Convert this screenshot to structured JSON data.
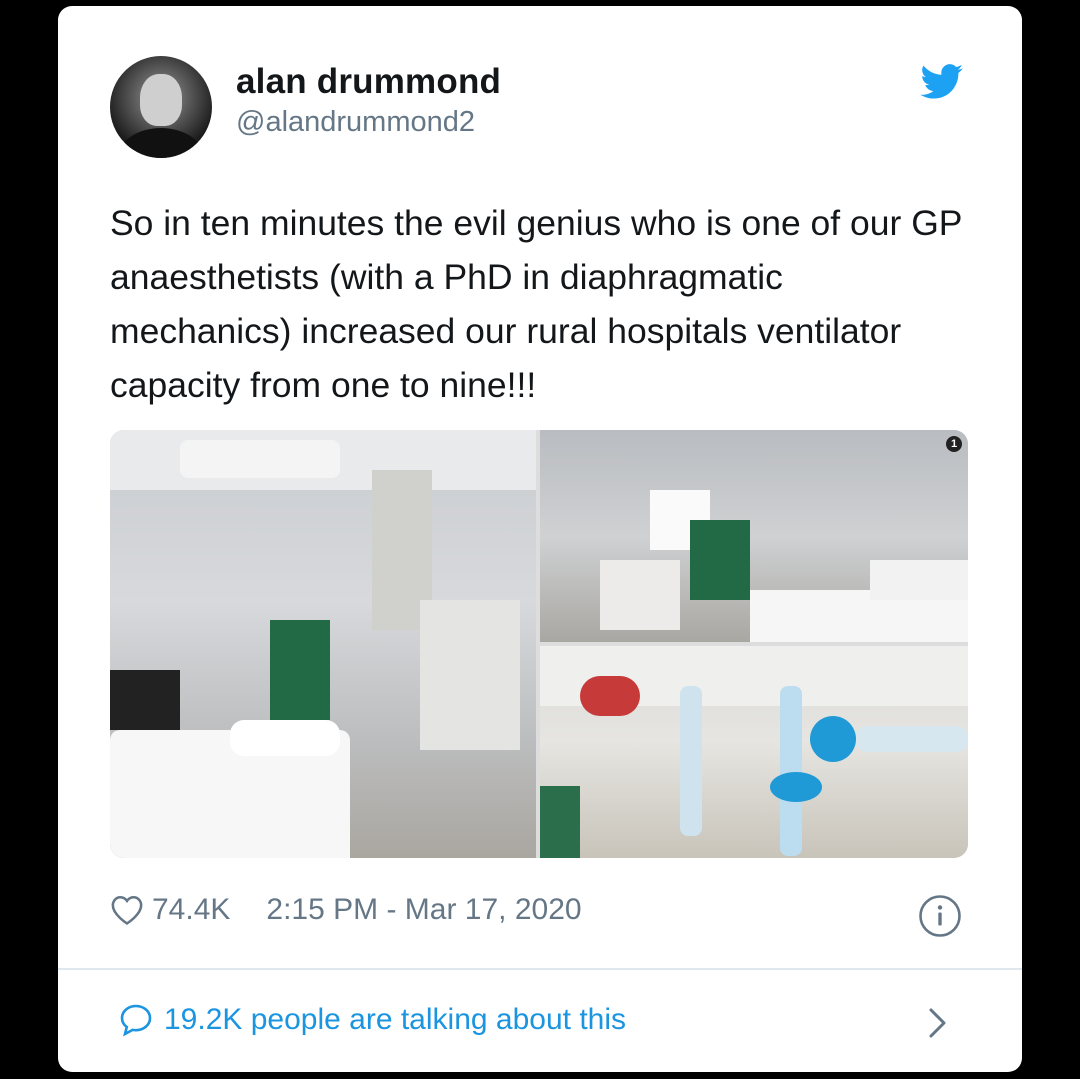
{
  "tweet": {
    "author_name": "alan drummond",
    "author_handle": "@alandrummond2",
    "text": "So in ten minutes the evil genius who is one of our GP anaesthetists (with a PhD in diaphragmatic mechanics) increased our rural hospitals ventilator capacity from one to nine!!!",
    "likes": "74.4K",
    "timestamp": "2:15 PM - Mar 17, 2020",
    "media_badge": "1",
    "talking": "19.2K people are talking about this"
  },
  "icons": {
    "brand": "twitter-bird-icon",
    "like": "heart-icon",
    "info": "info-icon",
    "reply": "speech-bubble-icon",
    "more": "chevron-right-icon"
  },
  "colors": {
    "brand_blue": "#1da1f2",
    "link_blue": "#1b95e0",
    "text": "#14171a",
    "secondary": "#657786"
  }
}
